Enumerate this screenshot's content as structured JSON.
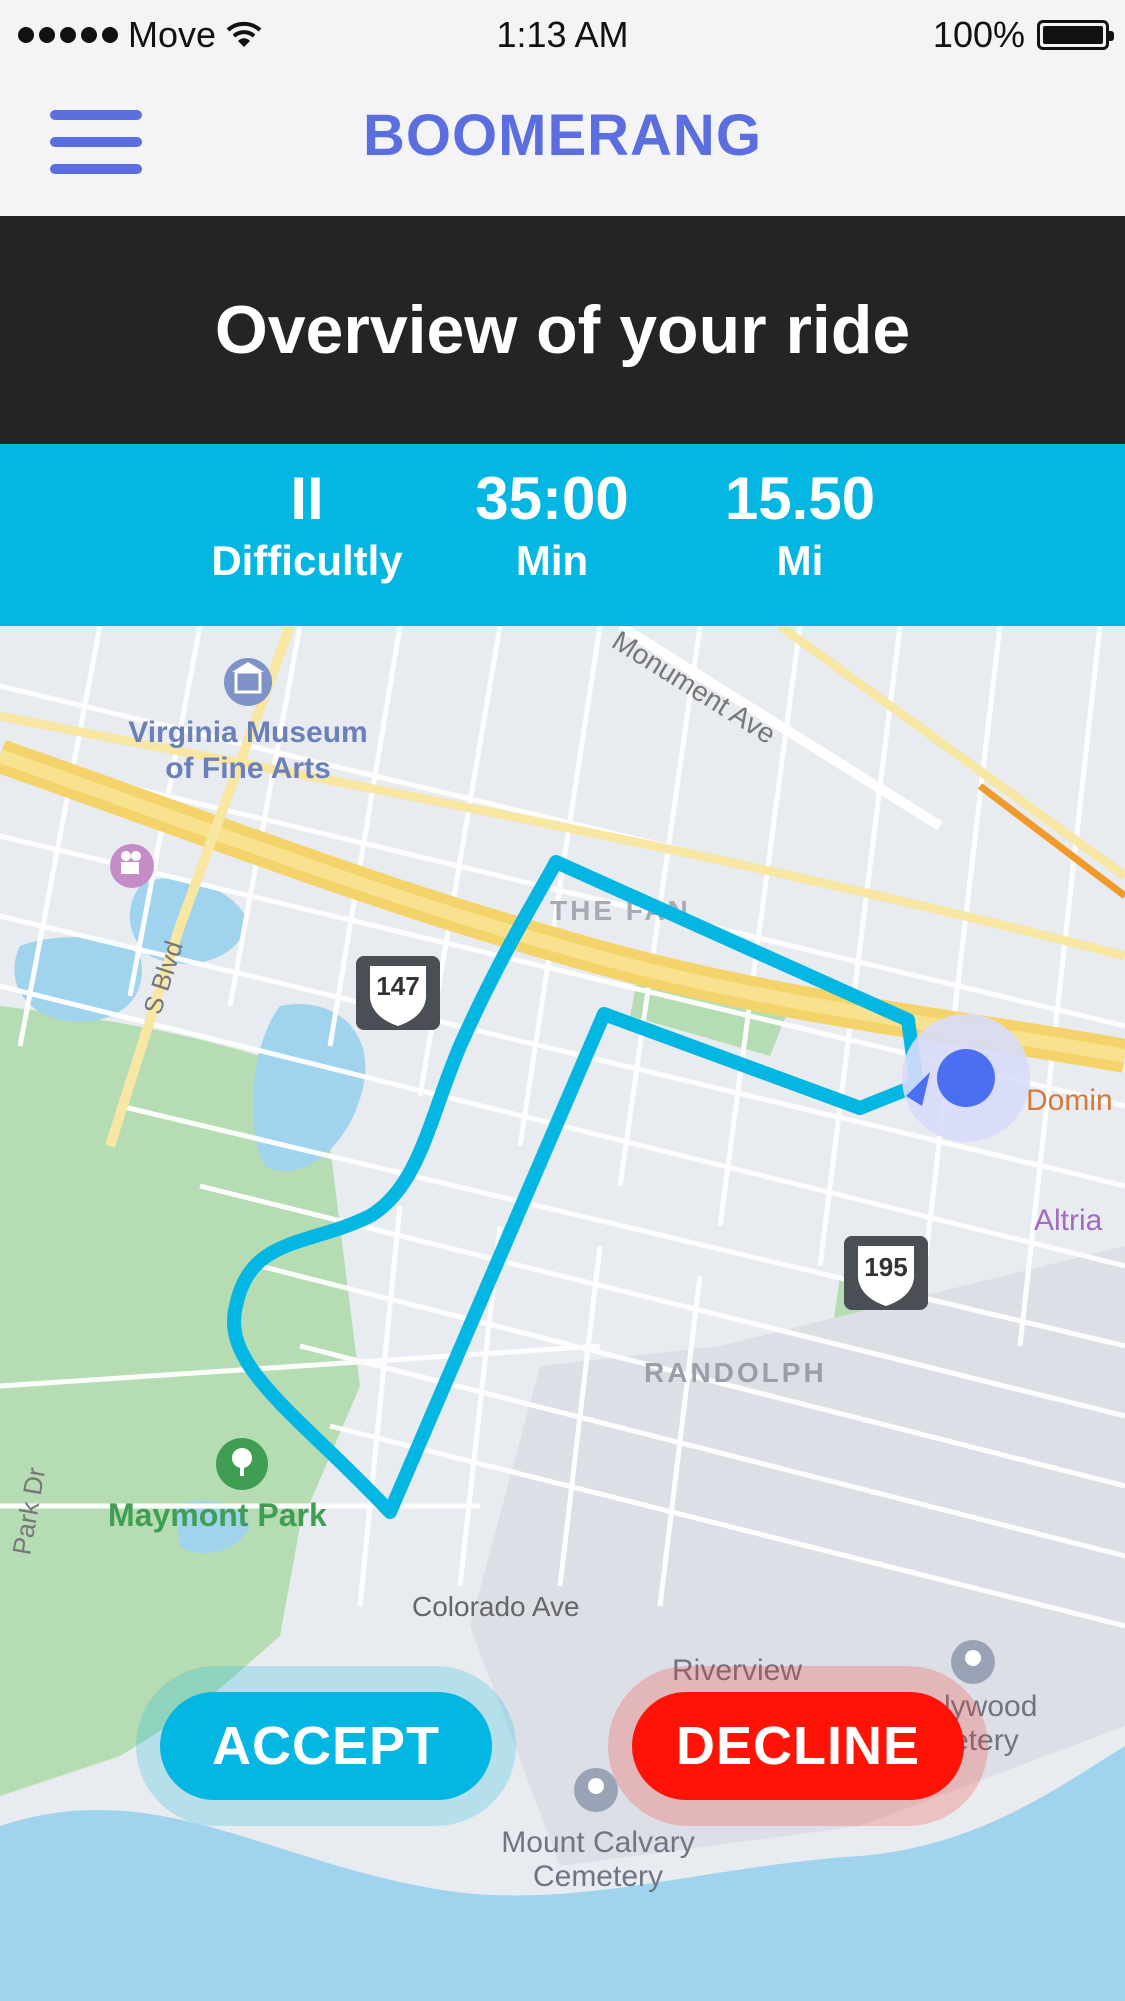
{
  "status_bar": {
    "carrier": "Move",
    "time": "1:13 AM",
    "battery": "100%"
  },
  "nav": {
    "title": "BOOMERANG"
  },
  "header": {
    "title": "Overview of your ride"
  },
  "stats": [
    {
      "value": "II",
      "label": "Difficultly"
    },
    {
      "value": "35:00",
      "label": "Min"
    },
    {
      "value": "15.50",
      "label": "Mi"
    }
  ],
  "map": {
    "labels": {
      "museum": [
        "Virginia Museum",
        "of Fine Arts"
      ],
      "monument": "Monument Ave",
      "fan": "THE FAN",
      "sblvd": "S Blvd",
      "route147": "147",
      "route195": "195",
      "dominion": "Domin",
      "altria": "Altria",
      "randolph": "RANDOLPH",
      "maymont": "Maymont Park",
      "parkdr": "Park Dr",
      "colorado": "Colorado Ave",
      "riverview": "Riverview",
      "hollywood": [
        "lywood",
        "etery"
      ],
      "mountcalvary": [
        "Mount Calvary",
        "Cemetery"
      ]
    },
    "route_color": "#04b6e2",
    "location_color": "#4a6ff0"
  },
  "actions": {
    "accept": "ACCEPT",
    "decline": "DECLINE"
  },
  "colors": {
    "brand": "#5b6ee0",
    "band": "#04b6e2",
    "header": "#242424",
    "decline": "#fe1306"
  }
}
